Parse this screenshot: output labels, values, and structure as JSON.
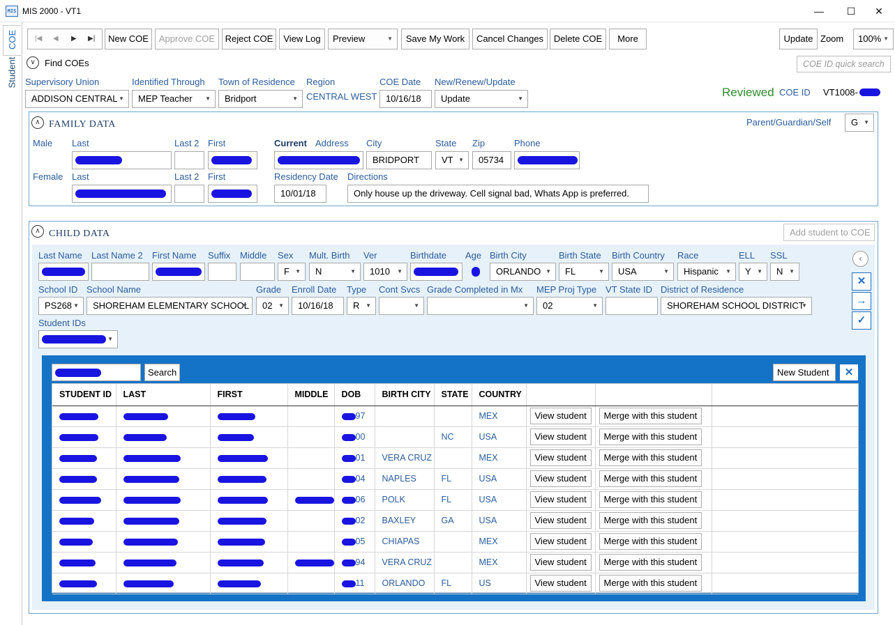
{
  "window": {
    "title": "MIS 2000 - VT1",
    "app_icon": "MIS"
  },
  "sidebar": {
    "tabs": [
      "COE",
      "Student"
    ]
  },
  "toolbar": {
    "new_coe": "New COE",
    "approve_coe": "Approve COE",
    "reject_coe": "Reject COE",
    "view_log": "View Log",
    "preview": "Preview",
    "save_my_work": "Save My Work",
    "cancel_changes": "Cancel Changes",
    "delete_coe": "Delete COE",
    "more": "More",
    "update": "Update",
    "zoom_label": "Zoom",
    "zoom_value": "100%"
  },
  "find": {
    "label": "Find COEs",
    "quick_search_placeholder": "COE ID quick search"
  },
  "coe_header": {
    "supervisory_union_label": "Supervisory Union",
    "supervisory_union": "ADDISON CENTRAL",
    "identified_through_label": "Identified Through",
    "identified_through": "MEP Teacher",
    "town_label": "Town of Residence",
    "town": "Bridport",
    "region_label": "Region",
    "region": "CENTRAL WEST",
    "coe_date_label": "COE Date",
    "coe_date": "10/16/18",
    "nru_label": "New/Renew/Update",
    "nru": "Update",
    "status": "Reviewed",
    "coe_id_label": "COE ID",
    "coe_id": "VT1008-",
    "status_color": "#2e8b2e"
  },
  "family": {
    "title": "FAMILY DATA",
    "parent_label": "Parent/Guardian/Self",
    "parent_value": "G",
    "male_label": "Male",
    "female_label": "Female",
    "last_label": "Last",
    "last2_label": "Last 2",
    "first_label": "First",
    "current_label": "Current",
    "address_label": "Address",
    "city_label": "City",
    "city": "BRIDPORT",
    "state_label": "State",
    "state": "VT",
    "zip_label": "Zip",
    "zip": "05734",
    "phone_label": "Phone",
    "residency_label": "Residency Date",
    "residency": "10/01/18",
    "directions_label": "Directions",
    "directions": "Only house up the driveway. Cell signal bad, Whats App is preferred."
  },
  "child": {
    "title": "CHILD DATA",
    "add_student": "Add student to COE",
    "labels": {
      "last_name": "Last Name",
      "last_name2": "Last Name 2",
      "first_name": "First Name",
      "suffix": "Suffix",
      "middle": "Middle",
      "sex": "Sex",
      "mult_birth": "Mult. Birth",
      "ver": "Ver",
      "birthdate": "Birthdate",
      "age": "Age",
      "birth_city": "Birth City",
      "birth_state": "Birth State",
      "birth_country": "Birth Country",
      "race": "Race",
      "ell": "ELL",
      "ssl": "SSL",
      "school_id": "School ID",
      "school_name": "School Name",
      "grade": "Grade",
      "enroll_date": "Enroll Date",
      "type": "Type",
      "cont_svcs": "Cont Svcs",
      "grade_completed": "Grade Completed in Mx",
      "mep_proj_type": "MEP Proj Type",
      "vt_state_id": "VT State ID",
      "district": "District of Residence",
      "student_ids": "Student IDs"
    },
    "values": {
      "sex": "F",
      "mult_birth": "N",
      "ver": "1010",
      "birth_city": "ORLANDO",
      "birth_state": "FL",
      "birth_country": "USA",
      "race": "Hispanic",
      "ell": "Y",
      "ssl": "N",
      "school_id": "PS268",
      "school_name": "SHOREHAM ELEMENTARY SCHOOL",
      "grade": "02",
      "enroll_date": "10/16/18",
      "type": "R",
      "mep_proj_type": "02",
      "district": "SHOREHAM SCHOOL DISTRICT"
    }
  },
  "search": {
    "search_button": "Search",
    "new_student": "New Student",
    "columns": [
      "STUDENT ID",
      "LAST",
      "FIRST",
      "MIDDLE",
      "DOB",
      "BIRTH CITY",
      "STATE",
      "COUNTRY"
    ],
    "view_label": "View student",
    "merge_label": "Merge with this student",
    "rows": [
      {
        "dob": "97",
        "city": "",
        "state": "",
        "country": "MEX"
      },
      {
        "dob": "00",
        "city": "",
        "state": "NC",
        "country": "USA"
      },
      {
        "dob": "01",
        "city": "VERA CRUZ",
        "state": "",
        "country": "MEX"
      },
      {
        "dob": "04",
        "city": "NAPLES",
        "state": "FL",
        "country": "USA"
      },
      {
        "dob": "06",
        "city": "POLK",
        "state": "FL",
        "country": "USA"
      },
      {
        "dob": "02",
        "city": "BAXLEY",
        "state": "GA",
        "country": "USA"
      },
      {
        "dob": "05",
        "city": "CHIAPAS",
        "state": "",
        "country": "MEX"
      },
      {
        "dob": "94",
        "city": "VERA CRUZ",
        "state": "",
        "country": "MEX"
      },
      {
        "dob": "11",
        "city": "ORLANDO",
        "state": "FL",
        "country": "US"
      }
    ]
  }
}
